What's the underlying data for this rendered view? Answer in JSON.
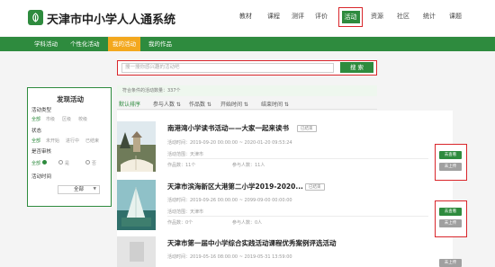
{
  "header": {
    "title": "天津市中小学人人通系统",
    "nav": [
      "教材",
      "课程",
      "测评",
      "评价",
      "活动",
      "资源",
      "社区",
      "统计",
      "课题"
    ],
    "active_nav": "活动"
  },
  "subnav": {
    "items": [
      "学科活动",
      "个性化活动",
      "我的活动",
      "我的作品"
    ],
    "active": "我的活动"
  },
  "search": {
    "placeholder": "搜一搜你感兴趣的活动吧",
    "button_label": "搜 索"
  },
  "sidebar": {
    "title": "发现活动",
    "groups": [
      {
        "label": "活动类型",
        "options": [
          "全部",
          "市级",
          "区级",
          "校级"
        ],
        "selected": "全部"
      },
      {
        "label": "状态",
        "options": [
          "全部",
          "未开始",
          "进行中",
          "已结束"
        ],
        "selected": "全部"
      },
      {
        "label": "是否审核",
        "options": [
          "全部",
          "是",
          "否"
        ],
        "selected": "全部"
      },
      {
        "label": "活动时间",
        "select_value": "全部"
      }
    ]
  },
  "results": {
    "count_text": "符合条件的活动数量：337个",
    "sort_options": [
      "默认排序",
      "参与人数 ⇅",
      "作品数 ⇅",
      "开始时间 ⇅",
      "结束时间 ⇅"
    ],
    "active_sort": "默认排序"
  },
  "activities": [
    {
      "title": "南港湾小学读书活动——大家一起来读书",
      "status": "已结束",
      "time": "活动时间：2019-09-20 00:00:00 ~ 2020-01-20 09:53:24",
      "area": "活动范围：天津市",
      "works": "作品数：11个",
      "participants": "参与人数：11人",
      "primary_btn": "去查看",
      "secondary_btn": "未上传"
    },
    {
      "title": "天津市滨海新区大港第二小学2019-2020...",
      "status": "已结束",
      "time": "活动时间：2019-09-26 00:00:00 ~ 2099-09-00 00:00:00",
      "area": "活动范围：天津市",
      "works": "作品数：0个",
      "participants": "参与人数：0人",
      "primary_btn": "去查看",
      "secondary_btn": "未上传"
    },
    {
      "title": "天津市第一届中小学综合实践活动课程优秀案例评选活动",
      "status": "",
      "time": "活动时间：2019-05-16 08:00:00 ~ 2019-05-31 13:59:00",
      "area": "",
      "works": "",
      "participants": "",
      "primary_btn": "",
      "secondary_btn": "未上传"
    }
  ],
  "colors": {
    "brand_green": "#2e8b3e",
    "active_orange": "#f3a81e",
    "highlight_red": "#d9262b"
  }
}
